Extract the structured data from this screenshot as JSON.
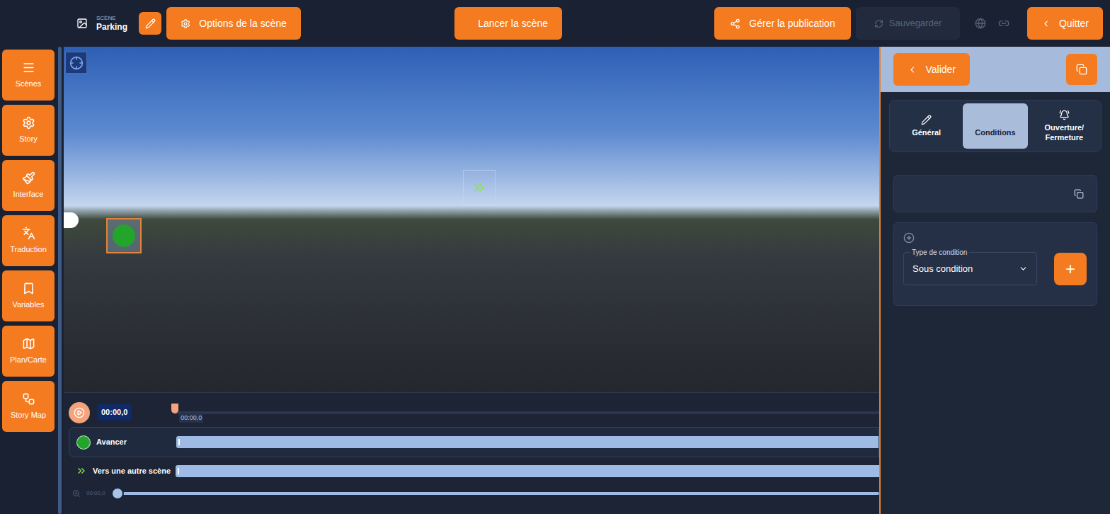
{
  "scene": {
    "label": "SCÈNE",
    "name": "Parking"
  },
  "toolbar": {
    "options": "Options de la scène",
    "launch": "Lancer la scène",
    "publish": "Gérer la publication",
    "save": {
      "label": "Sauvegarder",
      "disabled": true
    },
    "quit": "Quitter"
  },
  "sidebar": {
    "items": [
      {
        "label": "Scènes"
      },
      {
        "label": "Story"
      },
      {
        "label": "Interface"
      },
      {
        "label": "Traduction"
      },
      {
        "label": "Variables"
      },
      {
        "label": "Plan/Carte"
      },
      {
        "label": "Story Map"
      }
    ]
  },
  "timeline": {
    "time": "00:00,0",
    "playhead": "00:00,0",
    "tracks": [
      {
        "label": "Avancer",
        "kind": "dot",
        "color": "#22a52a"
      },
      {
        "label": "Vers une autre scène",
        "kind": "arrow",
        "color": "#8fe05a"
      }
    ],
    "zoom": {
      "reading": "00:00,0",
      "level": 0
    }
  },
  "panel": {
    "validate": "Valider",
    "tabs": [
      {
        "label": "Général",
        "selected": false
      },
      {
        "label": "Conditions",
        "selected": true
      },
      {
        "label": "Ouverture/ Fermeture",
        "selected": false
      }
    ],
    "condition": {
      "type_label": "Type de condition",
      "type_value": "Sous condition",
      "add": "+"
    }
  }
}
